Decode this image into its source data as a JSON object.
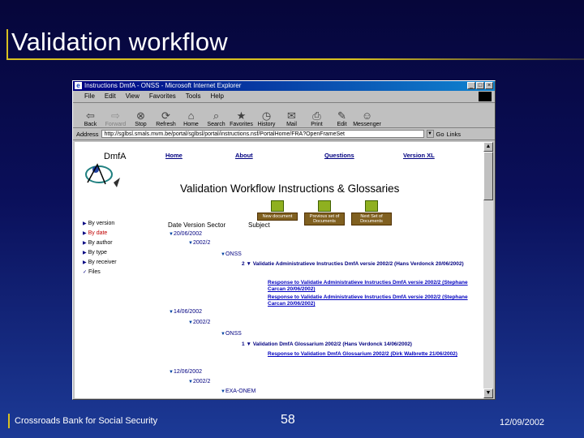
{
  "slide": {
    "title": "Validation workflow",
    "footer_org": "Crossroads Bank for Social Security",
    "page_number": "58",
    "date": "12/09/2002"
  },
  "browser": {
    "window_title": "Instructions DmfA - ONSS - Microsoft Internet Explorer",
    "menu": [
      "File",
      "Edit",
      "View",
      "Favorites",
      "Tools",
      "Help"
    ],
    "toolbar": [
      {
        "label": "Back",
        "icon": "back-arrow-icon",
        "glyph": "⇦"
      },
      {
        "label": "Forward",
        "icon": "forward-arrow-icon",
        "glyph": "⇨"
      },
      {
        "label": "Stop",
        "icon": "stop-icon",
        "glyph": "⊗"
      },
      {
        "label": "Refresh",
        "icon": "refresh-icon",
        "glyph": "⟳"
      },
      {
        "label": "Home",
        "icon": "home-icon",
        "glyph": "⌂"
      },
      {
        "label": "Search",
        "icon": "search-icon",
        "glyph": "⌕"
      },
      {
        "label": "Favorites",
        "icon": "favorites-icon",
        "glyph": "★"
      },
      {
        "label": "History",
        "icon": "history-icon",
        "glyph": "◷"
      },
      {
        "label": "Mail",
        "icon": "mail-icon",
        "glyph": "✉"
      },
      {
        "label": "Print",
        "icon": "print-icon",
        "glyph": "⎙"
      },
      {
        "label": "Edit",
        "icon": "edit-icon",
        "glyph": "✎"
      },
      {
        "label": "Messenger",
        "icon": "messenger-icon",
        "glyph": "☺"
      }
    ],
    "address_label": "Address",
    "address_value": "http://sglbsl.smals.mvm.be/portal/sglbsl/portal/instructions.nsf/PortalHome/FRA?OpenFrameSet",
    "go_label": "Go",
    "links_label": "Links"
  },
  "page": {
    "logo_text": "DmfA",
    "nav_links": [
      "Home",
      "About",
      "Questions",
      "Version XL"
    ],
    "heading": "Validation Workflow Instructions & Glossaries",
    "doc_buttons": [
      "New document",
      "Previous set of Documents",
      "Next Set of Documents"
    ],
    "left_nav": [
      "By version",
      "By date",
      "By author",
      "By type",
      "By receiver",
      "Files"
    ],
    "column_header": "Date Version Sector",
    "subject_header": "Subject",
    "tree": [
      {
        "text": "20/06/2002"
      },
      {
        "text": "2002/2"
      },
      {
        "text": "ONSS"
      },
      {
        "text": "14/06/2002"
      },
      {
        "text": "2002/2"
      },
      {
        "text": "ONSS"
      },
      {
        "text": "12/06/2002"
      },
      {
        "text": "2002/2"
      },
      {
        "text": "EXA-ONEM"
      }
    ],
    "entries": [
      {
        "count": "2",
        "text": "Validatie Administratieve Instructies DmfA versie 2002/2 (Hans Verdonck 20/06/2002)"
      },
      {
        "text": "Response to Validatie Administratieve Instructies DmfA versie 2002/2 (Stephane Carcan 20/06/2002)"
      },
      {
        "text": "Response to Validatie Administratieve Instructies DmfA versie 2002/2 (Stephane Carcan 20/06/2002)"
      },
      {
        "count": "1",
        "text": "Validation DmfA Glossarium 2002/2 (Hans Verdonck 14/06/2002)"
      },
      {
        "text": "Response to Validation DmfA Glossarium 2002/2 (Dirk Walbrette 21/06/2002)"
      }
    ]
  }
}
